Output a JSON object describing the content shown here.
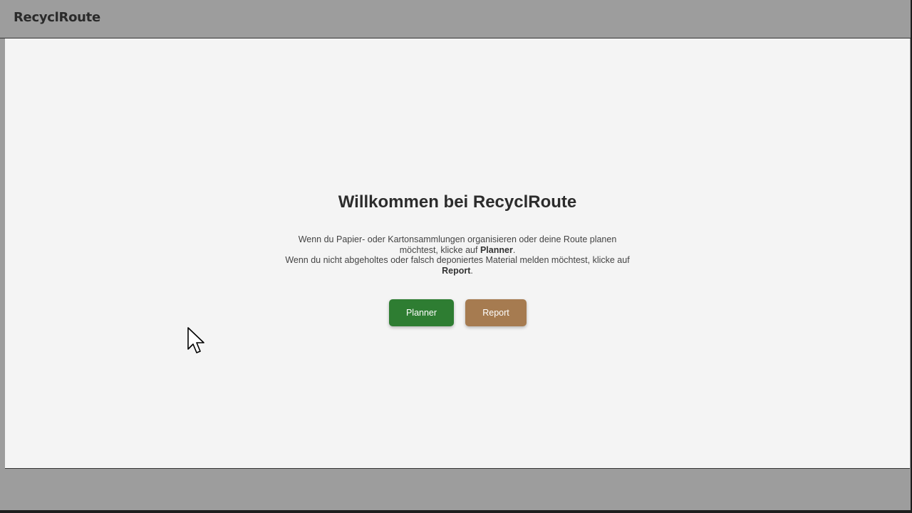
{
  "app": {
    "brand": "RecyclRoute"
  },
  "main": {
    "title": "Willkommen bei RecyclRoute",
    "description": {
      "line1_pre": "Wenn du Papier- oder Kartonsammlungen organisieren oder deine Route planen möchtest, klicke auf ",
      "line1_bold": "Planner",
      "line1_post": ".",
      "line2_pre": "Wenn du nicht abgeholtes oder falsch deponiertes Material melden möchtest, klicke auf ",
      "line2_bold": "Report",
      "line2_post": "."
    },
    "buttons": {
      "planner_label": "Planner",
      "report_label": "Report"
    }
  },
  "colors": {
    "header_bg": "#9d9d9d",
    "main_bg": "#f4f4f4",
    "planner_btn": "#2e7d32",
    "report_btn": "#a67b50"
  },
  "icons": {
    "cursor": "mouse-pointer-icon"
  }
}
